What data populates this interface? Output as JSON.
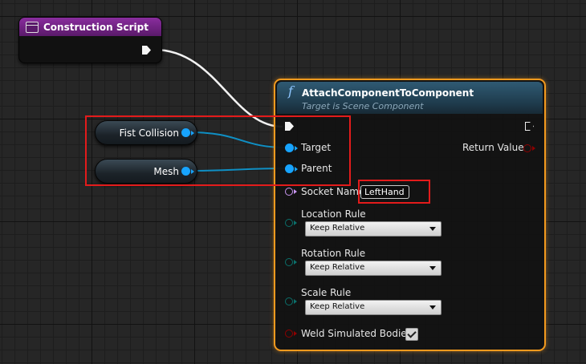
{
  "construction_script": {
    "title": "Construction Script"
  },
  "variables": [
    {
      "label": "Fist Collision"
    },
    {
      "label": "Mesh"
    }
  ],
  "function_node": {
    "icon_glyph": "f",
    "title": "AttachComponentToComponent",
    "subtitle": "Target is Scene Component",
    "target_label": "Target",
    "parent_label": "Parent",
    "return_label": "Return Value",
    "socket_label": "Socket Name",
    "socket_value": "LeftHand",
    "location_rule": {
      "label": "Location Rule",
      "value": "Keep Relative"
    },
    "rotation_rule": {
      "label": "Rotation Rule",
      "value": "Keep Relative"
    },
    "scale_rule": {
      "label": "Scale Rule",
      "value": "Keep Relative"
    },
    "weld_label": "Weld Simulated Bodies",
    "weld_checked": true
  },
  "colors": {
    "object_pin": "#17a4ff",
    "name_pin": "#c896f0",
    "enum_pin": "#0b6f6a",
    "bool_pin": "#8f0000",
    "return_pin": "#8f0000",
    "highlight": "#e31b1b",
    "selection": "#f39a1e",
    "event_header": "#8a2d9e"
  }
}
